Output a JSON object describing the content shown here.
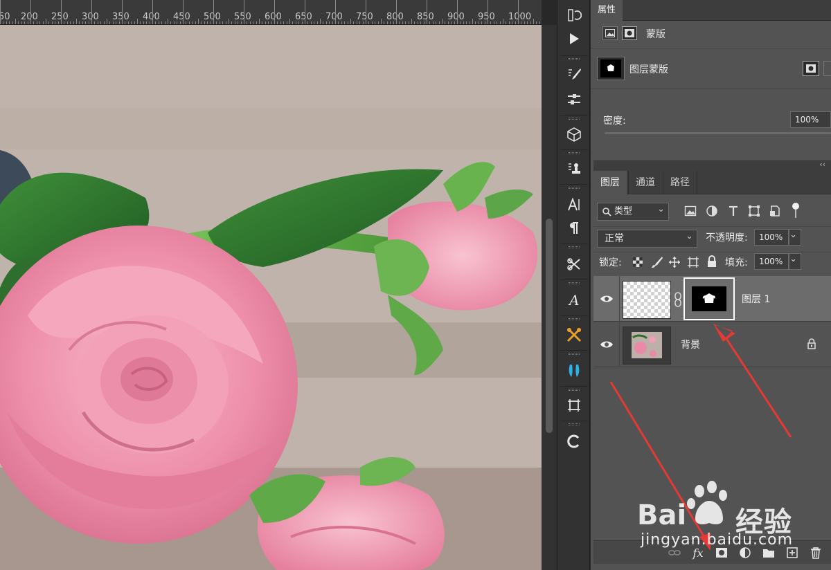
{
  "ruler": {
    "labels": [
      "50",
      "200",
      "250",
      "300",
      "350",
      "400",
      "450",
      "500",
      "550",
      "600",
      "650",
      "700",
      "750",
      "800",
      "850",
      "900",
      "950",
      "1000"
    ]
  },
  "properties": {
    "tab": "属性",
    "mask_section": "蒙版",
    "layer_mask_label": "图层蒙版",
    "density_label": "密度:",
    "density_value": "100%"
  },
  "layers_panel": {
    "collapse": "‹‹",
    "tabs": [
      {
        "label": "图层"
      },
      {
        "label": "通道"
      },
      {
        "label": "路径"
      }
    ],
    "filter_kind": "类型",
    "blend_mode": "正常",
    "opacity_label": "不透明度:",
    "opacity_value": "100%",
    "lock_label": "锁定:",
    "fill_label": "填充:",
    "fill_value": "100%",
    "layers": [
      {
        "name": "图层 1",
        "selected": true
      },
      {
        "name": "背景",
        "selected": false
      }
    ],
    "bottom_fx": "fx"
  },
  "watermark": {
    "brand": "Bai",
    "brand_cn": "经验",
    "url": "jingyan.baidu.com"
  },
  "colors": {
    "panel": "#535353",
    "dark": "#3d3d3d",
    "arrow": "#e53935",
    "selected_row": "#6c6c6c"
  }
}
